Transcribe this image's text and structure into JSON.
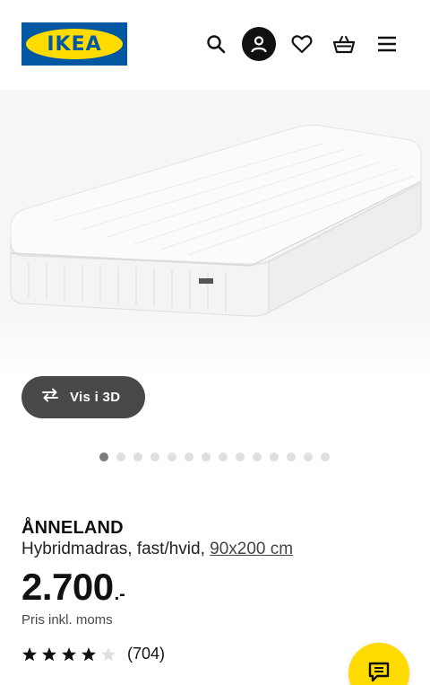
{
  "header": {
    "logo_text": "IKEA",
    "icons": [
      "search-icon",
      "user-icon",
      "heart-icon",
      "basket-icon",
      "menu-icon"
    ]
  },
  "gallery": {
    "view_3d_label": "Vis i 3D",
    "dot_count": 14,
    "active_dot": 0
  },
  "product": {
    "name": "ÅNNELAND",
    "description": "Hybridmadras, fast/hvid, ",
    "size": "90x200 cm",
    "price": "2.700",
    "price_suffix": ".-",
    "price_note": "Pris inkl. moms",
    "rating": 4,
    "rating_max": 5,
    "review_count": "(704)"
  },
  "colors": {
    "brand_blue": "#0058a3",
    "brand_yellow": "#ffdb00",
    "button_dark": "#484848"
  }
}
